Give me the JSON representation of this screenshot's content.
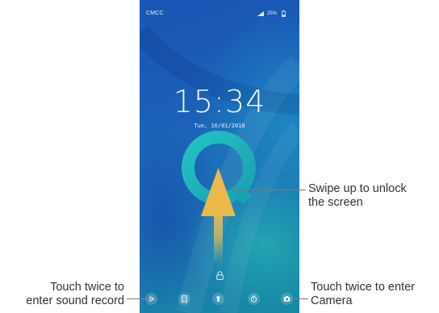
{
  "status_bar": {
    "carrier": "CMCC",
    "battery": "25%"
  },
  "lock_screen": {
    "time": "15:34",
    "date": "Tue, 16/01/2018"
  },
  "dock": {
    "items": [
      "sound-recorder-icon",
      "calculator-icon",
      "flashlight-icon",
      "timer-icon",
      "camera-icon"
    ]
  },
  "callouts": {
    "unlock_line1": "Swipe up to unlock",
    "unlock_line2": "the screen",
    "sound_line1": "Touch twice to",
    "sound_line2": "enter sound record",
    "camera_line1": "Touch twice to enter",
    "camera_line2": "Camera"
  },
  "colors": {
    "wallpaper_blue": "#1b60b8",
    "wallpaper_teal": "#168aa3",
    "arrow_gold": "#e6b84a",
    "callout_text": "#333333"
  }
}
